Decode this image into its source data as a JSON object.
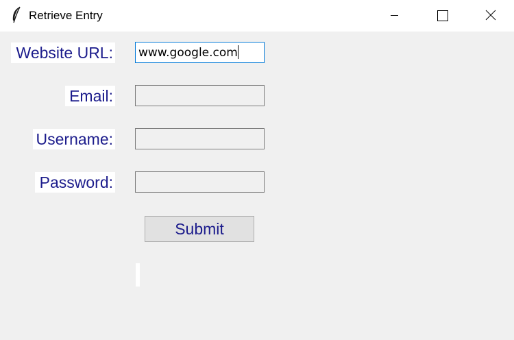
{
  "window": {
    "title": "Retrieve Entry",
    "icon": "feather-icon"
  },
  "controls": {
    "minimize_icon": "minimize-icon",
    "maximize_icon": "maximize-icon",
    "close_icon": "close-icon"
  },
  "form": {
    "website_label": "Website URL:",
    "email_label": "Email:",
    "username_label": "Username:",
    "password_label": "Password:",
    "website_value": "www.google.com",
    "email_value": "",
    "username_value": "",
    "password_value": "",
    "submit_label": "Submit",
    "result_text": ""
  },
  "colors": {
    "label_text": "#1c1c8c",
    "background": "#f0f0f0",
    "focus_border": "#0078d7"
  }
}
